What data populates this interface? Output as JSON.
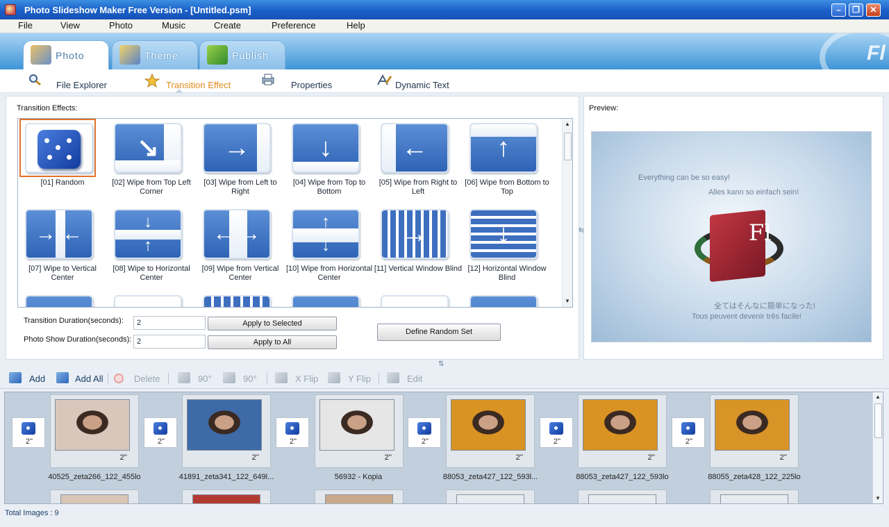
{
  "window": {
    "title": "Photo Slideshow Maker Free Version - [Untitled.psm]",
    "min": "–",
    "max": "❐",
    "close": "✕"
  },
  "menu": [
    "File",
    "View",
    "Photo",
    "Music",
    "Create",
    "Preference",
    "Help"
  ],
  "main_tabs": [
    {
      "label": "Photo",
      "active": true,
      "icon": "photo-icon"
    },
    {
      "label": "Theme",
      "active": false,
      "icon": "theme-icon"
    },
    {
      "label": "Publish",
      "active": false,
      "icon": "publish-icon"
    }
  ],
  "sub_tabs": [
    {
      "label": "File Explorer",
      "icon": "magnifier-icon"
    },
    {
      "label": "Transition Effect",
      "icon": "star-icon",
      "active": true
    },
    {
      "label": "Properties",
      "icon": "printer-icon"
    },
    {
      "label": "Dynamic Text",
      "icon": "text-icon"
    }
  ],
  "effects_panel": {
    "label": "Transition Effects:",
    "items": [
      {
        "caption": "[01] Random",
        "selected": true
      },
      {
        "caption": "[02] Wipe from Top Left Corner"
      },
      {
        "caption": "[03] Wipe from Left to Right"
      },
      {
        "caption": "[04] Wipe from Top to Bottom"
      },
      {
        "caption": "[05] Wipe from Right to Left"
      },
      {
        "caption": "[06] Wipe from Bottom to Top"
      },
      {
        "caption": "[07] Wipe to Vertical Center"
      },
      {
        "caption": "[08] Wipe to Horizontal Center"
      },
      {
        "caption": "[09] Wipe from Vertical Center"
      },
      {
        "caption": "[10] Wipe from Horizontal Center"
      },
      {
        "caption": "[11] Vertical Window Blind"
      },
      {
        "caption": "[12] Horizontal Window Blind"
      }
    ],
    "transition_duration_label": "Transition Duration(seconds):",
    "transition_duration_value": "2",
    "photo_duration_label": "Photo Show Duration(seconds):",
    "photo_duration_value": "2",
    "apply_selected": "Apply to Selected",
    "apply_all": "Apply to All",
    "define_random": "Define Random Set"
  },
  "preview": {
    "label": "Preview:",
    "lines": [
      "Everything can be so easy!",
      "Alles kann so einfach sein!",
      "全てはそんなに簡単になった!",
      "Tous peuvent devenir três facile!"
    ],
    "logo_text": "Fl"
  },
  "toolbar": [
    {
      "label": "Add",
      "enabled": true
    },
    {
      "label": "Add All",
      "enabled": true
    },
    {
      "label": "Delete",
      "enabled": false
    },
    {
      "label": "90°",
      "enabled": false
    },
    {
      "label": "90°",
      "enabled": false
    },
    {
      "label": "X Flip",
      "enabled": false
    },
    {
      "label": "Y Flip",
      "enabled": false
    },
    {
      "label": "Edit",
      "enabled": false
    }
  ],
  "filmstrip": {
    "transition_duration": "2''",
    "photos": [
      {
        "name": "40525_zeta266_122_455lo",
        "duration": "2''",
        "tone": "#d8c8bc"
      },
      {
        "name": "41891_zeta341_122_649l...",
        "duration": "2''",
        "tone": "#3f6aa8"
      },
      {
        "name": "56932 - Kopia",
        "duration": "2''",
        "tone": "#e6e6e6"
      },
      {
        "name": "88053_zeta427_122_593l...",
        "duration": "2''",
        "tone": "#d99322"
      },
      {
        "name": "88053_zeta427_122_593lo",
        "duration": "2''",
        "tone": "#d99322"
      },
      {
        "name": "88055_zeta428_122_225lo",
        "duration": "2''",
        "tone": "#d89426"
      }
    ]
  },
  "status": {
    "total": "Total Images : 9"
  }
}
